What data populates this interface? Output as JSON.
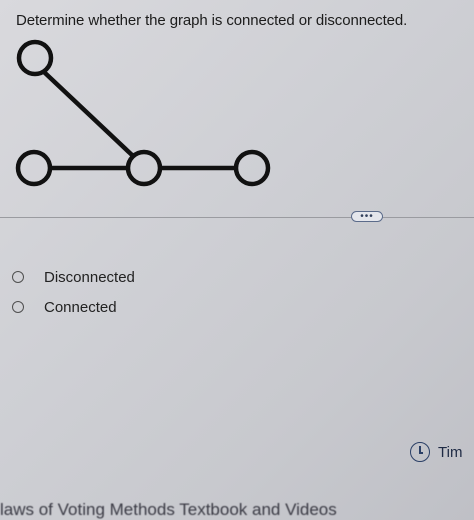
{
  "question": {
    "text": "Determine whether the graph is connected or disconnected."
  },
  "toolbar": {
    "more_label": "•••"
  },
  "options": [
    {
      "label": "Disconnected",
      "selected": false
    },
    {
      "label": "Connected",
      "selected": false
    }
  ],
  "timer": {
    "label": "Tim",
    "icon": "clock-icon"
  },
  "footer": {
    "link_text": "laws of Voting Methods Textbook and Videos"
  },
  "colors": {
    "background": "#cfd0d5",
    "graph_stroke": "#111111",
    "accent": "#2a3f66"
  }
}
